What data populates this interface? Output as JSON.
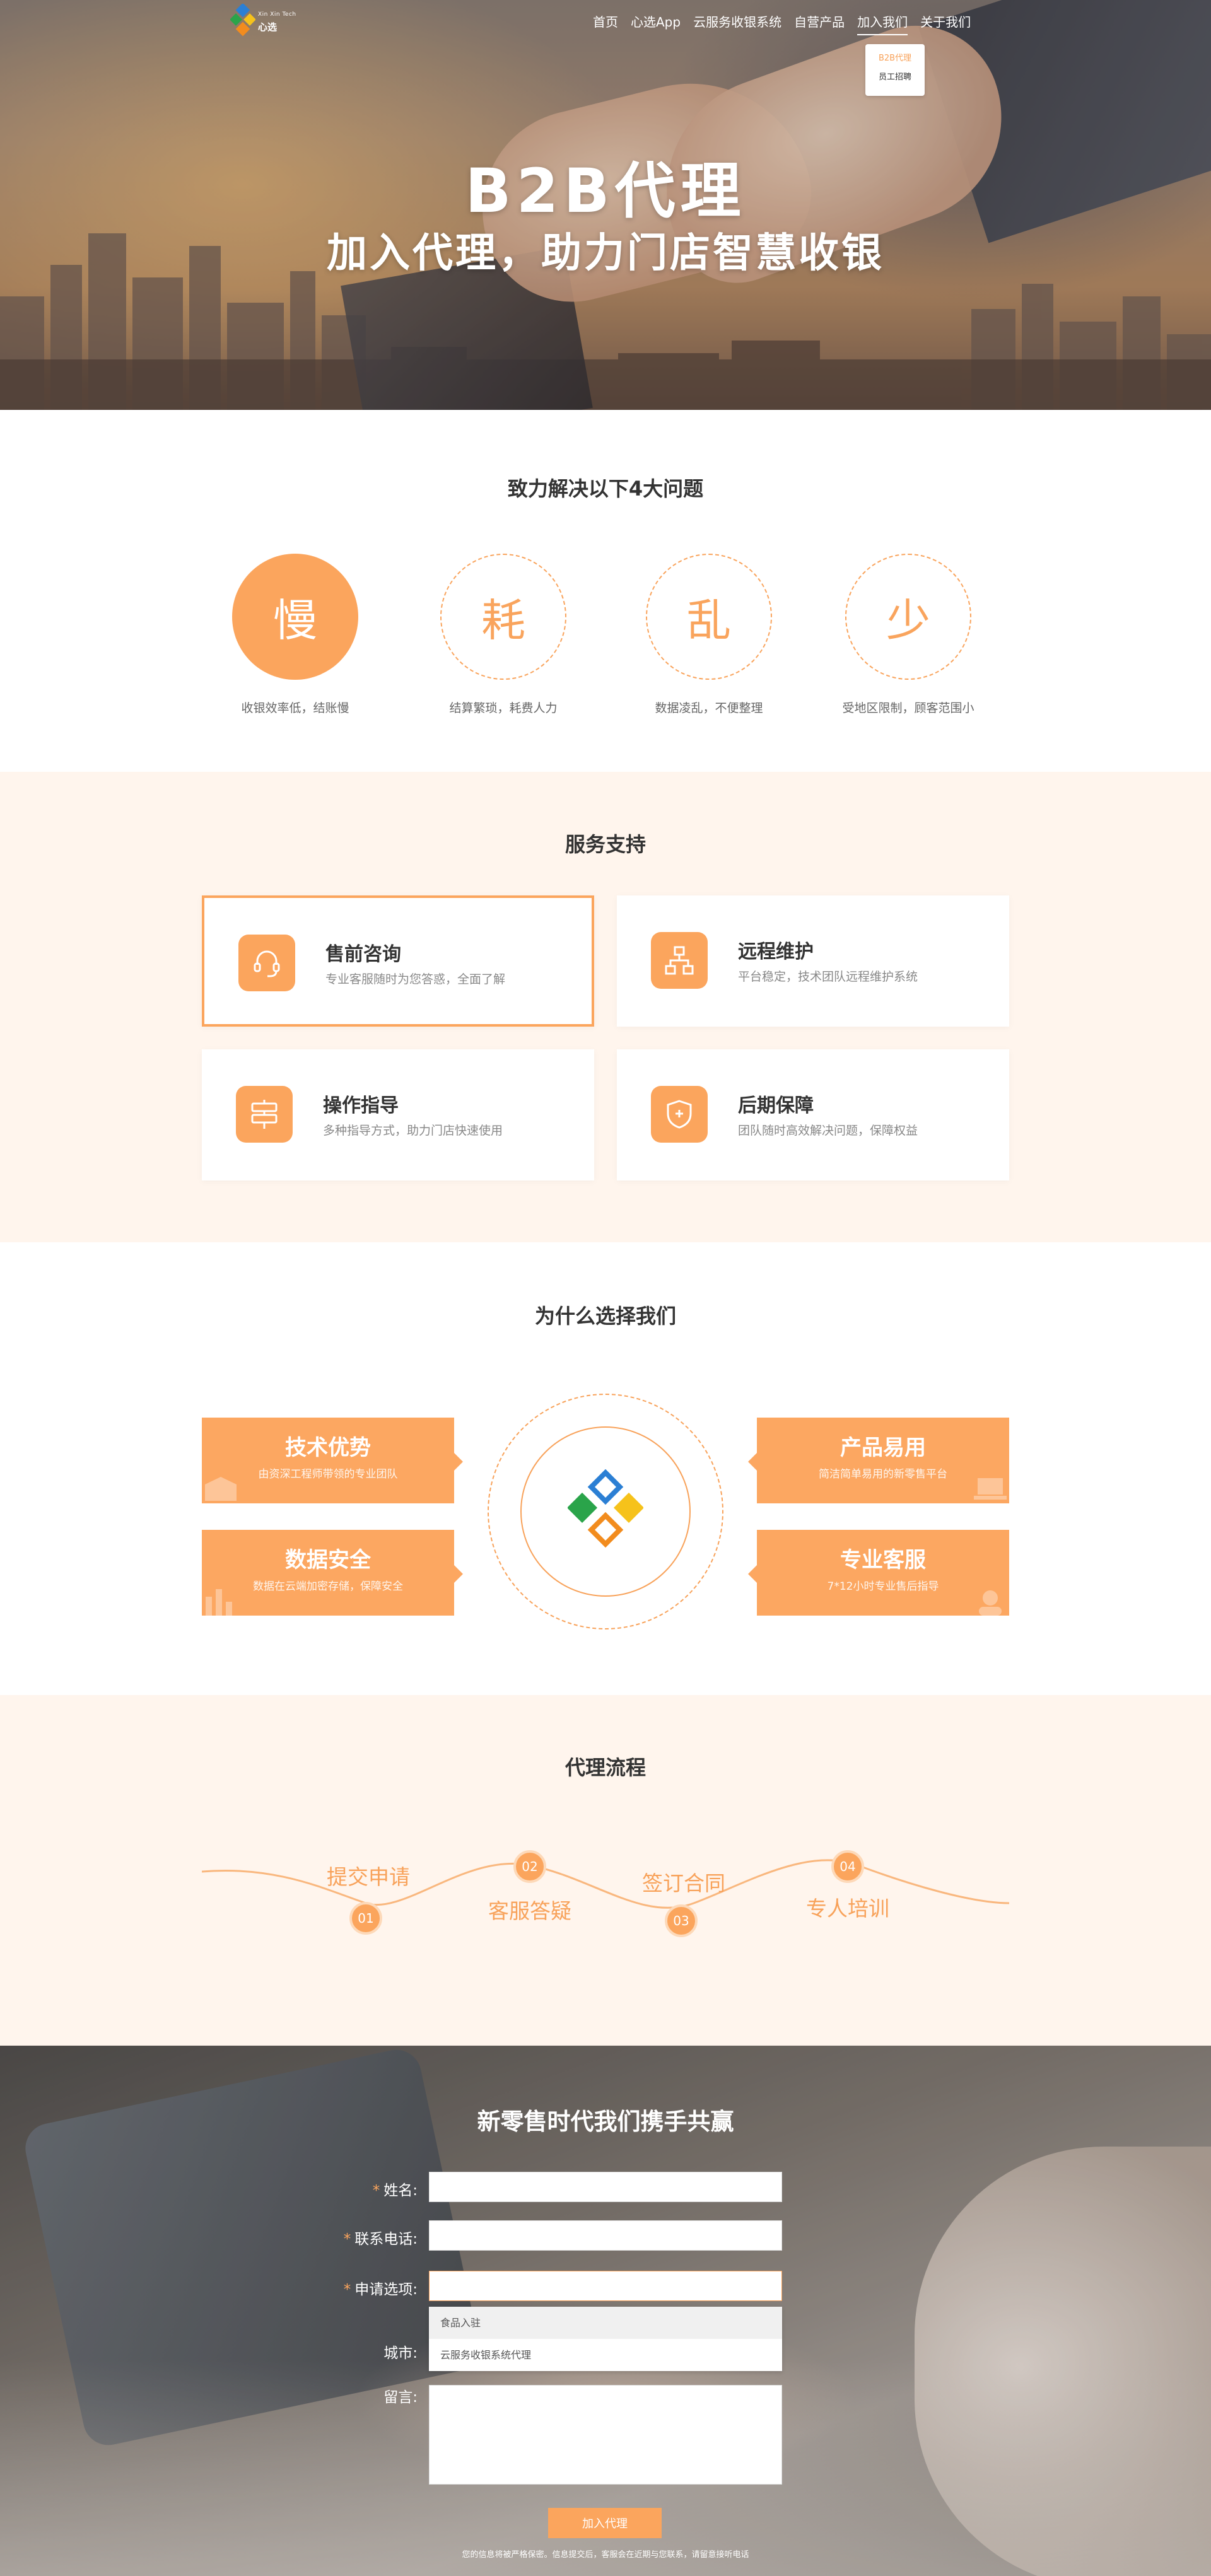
{
  "nav": {
    "logo_top": "Xin Xin Tech",
    "logo_main": "心选",
    "menu": [
      "首页",
      "心选App",
      "云服务收银系统",
      "自营产品",
      "加入我们",
      "关于我们"
    ],
    "dropdown": [
      "B2B代理",
      "员工招聘"
    ]
  },
  "hero": {
    "title": "B2B代理",
    "subtitle": "加入代理，助力门店智慧收银"
  },
  "problems": {
    "title": "致力解决以下4大问题",
    "items": [
      {
        "char": "慢",
        "caption": "收银效率低，结账慢"
      },
      {
        "char": "耗",
        "caption": "结算繁琐，耗费人力"
      },
      {
        "char": "乱",
        "caption": "数据凌乱，不便整理"
      },
      {
        "char": "少",
        "caption": "受地区限制，顾客范围小"
      }
    ]
  },
  "services": {
    "title": "服务支持",
    "cards": [
      {
        "title": "售前咨询",
        "desc": "专业客服随时为您答惑，全面了解",
        "icon": "headset-icon"
      },
      {
        "title": "远程维护",
        "desc": "平台稳定，技术团队远程维护系统",
        "icon": "network-icon"
      },
      {
        "title": "操作指导",
        "desc": "多种指导方式，助力门店快速使用",
        "icon": "signpost-icon"
      },
      {
        "title": "后期保障",
        "desc": "团队随时高效解决问题，保障权益",
        "icon": "shield-icon"
      }
    ]
  },
  "why": {
    "title": "为什么选择我们",
    "cards": [
      {
        "title": "技术优势",
        "desc": "由资深工程师带领的专业团队"
      },
      {
        "title": "产品易用",
        "desc": "简洁简单易用的新零售平台"
      },
      {
        "title": "数据安全",
        "desc": "数据在云端加密存储，保障安全"
      },
      {
        "title": "专业客服",
        "desc": "7*12小时专业售后指导"
      }
    ]
  },
  "process": {
    "title": "代理流程",
    "steps": [
      {
        "num": "01",
        "label": "提交申请"
      },
      {
        "num": "02",
        "label": "客服答疑"
      },
      {
        "num": "03",
        "label": "签订合同"
      },
      {
        "num": "04",
        "label": "专人培训"
      }
    ]
  },
  "join": {
    "title": "新零售时代我们携手共赢",
    "labels": {
      "name": "姓名:",
      "phone": "联系电话:",
      "option": "申请选项:",
      "city": "城市:",
      "message": "留言:"
    },
    "options": [
      "食品入驻",
      "云服务收银系统代理"
    ],
    "submit": "加入代理",
    "note": "您的信息将被严格保密。信息提交后，客服会在近期与您联系，请留意接听电话"
  },
  "colors": {
    "accent": "#fba55d",
    "light_bg": "#fff5ed"
  }
}
